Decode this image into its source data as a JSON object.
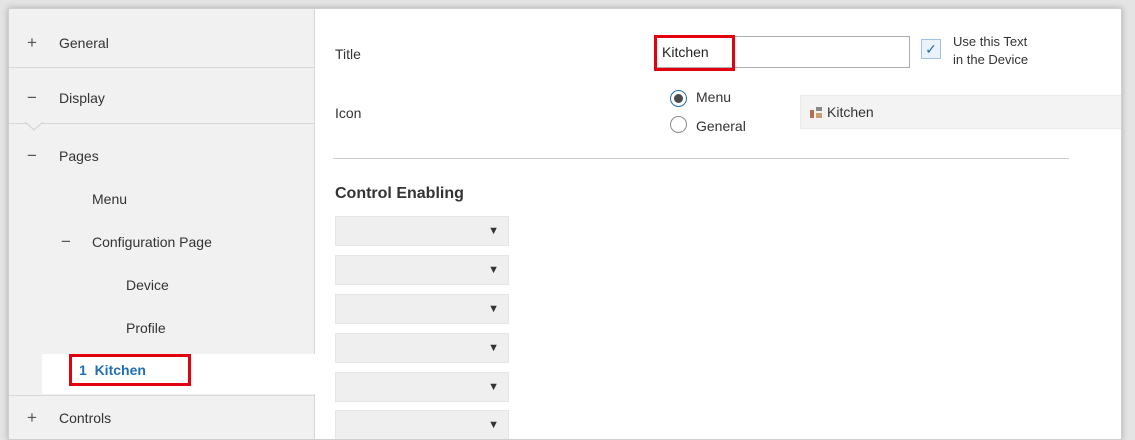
{
  "sidebar": {
    "items": [
      {
        "symbol": "+",
        "label": "General"
      },
      {
        "symbol": "−",
        "label": "Display"
      },
      {
        "symbol": "−",
        "label": "Pages"
      },
      {
        "label": "Menu"
      },
      {
        "symbol": "−",
        "label": "Configuration Page"
      },
      {
        "label": "Device"
      },
      {
        "label": "Profile"
      },
      {
        "label": "1  Kitchen"
      },
      {
        "symbol": "+",
        "label": "Controls"
      }
    ]
  },
  "main": {
    "title_label": "Title",
    "title_value": "Kitchen",
    "use_text_line1": "Use this Text",
    "use_text_line2": "in the Device",
    "use_text_checked": true,
    "icon_label": "Icon",
    "radio_menu": "Menu",
    "radio_general": "General",
    "icon_select_value": "Kitchen",
    "section_title": "Control Enabling",
    "control_selects": [
      "",
      "",
      "",
      "",
      "",
      ""
    ]
  },
  "icons": {
    "expand": "plus-icon",
    "collapse": "minus-icon",
    "check": "checkmark-icon",
    "dropdown": "caret-down-icon",
    "kitchen": "kitchen-icon"
  },
  "colors": {
    "highlight": "#e3000f",
    "selected_text": "#1f6fb2",
    "sidebar_bg": "#f1f1f1"
  }
}
